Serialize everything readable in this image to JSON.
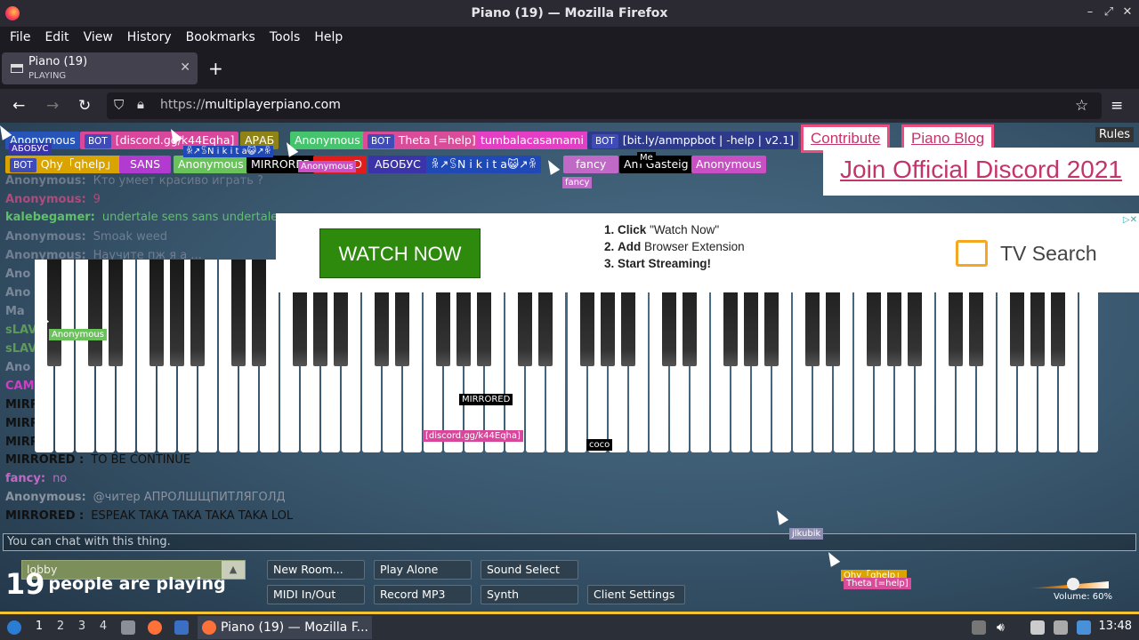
{
  "window": {
    "title": "Piano (19) — Mozilla Firefox"
  },
  "menu": [
    "File",
    "Edit",
    "View",
    "History",
    "Bookmarks",
    "Tools",
    "Help"
  ],
  "tab": {
    "title": "Piano (19)",
    "status": "PLAYING"
  },
  "url": {
    "scheme": "https://",
    "host": "multiplayerpiano.com"
  },
  "users_row1": [
    {
      "name": "Anonymous",
      "color": "#2754b8"
    },
    {
      "name": "[discord.gg/k44Eqha]",
      "color": "#d9479c",
      "bot": "BOT"
    },
    {
      "name": "АРАБ",
      "color": "#8f8217"
    },
    {
      "name": "Anonymous",
      "color": "#45c46d"
    },
    {
      "name": "Theta [=help]",
      "color": "#d94c9a",
      "bot": "BOT"
    },
    {
      "name": "tumbalacasamami",
      "color": "#e43fc4"
    },
    {
      "name": "[bit.ly/anmppbot | -help | v2.1]",
      "color": "#2d3a8c",
      "bot": "BOT"
    }
  ],
  "users_row2": [
    {
      "name": "Qhy「qhelp」",
      "color": "#d9a400",
      "bot": "BOT"
    },
    {
      "name": "SANS",
      "color": "#b23ad1"
    },
    {
      "name": "Anonymous",
      "color": "#69c35a"
    },
    {
      "name": "MIRRORED",
      "color": "#000000"
    },
    {
      "name": "D",
      "color": "#e01d1d"
    },
    {
      "name": "АБОБУС",
      "color": "#3b34a8"
    },
    {
      "name": "ꆜ↗ꌗN i k i t a😺↗ꆜ",
      "color": "#2049b8"
    },
    {
      "name": "fancy",
      "color": "#c169c6"
    },
    {
      "name": "Am Gasteig",
      "color": "#000000"
    },
    {
      "name": "Anonymous",
      "color": "#c94fc4"
    }
  ],
  "header_links": {
    "contribute": "Contribute",
    "blog": "Piano Blog",
    "join": "Join Official Discord 2021",
    "rules": "Rules"
  },
  "chat": [
    {
      "name": "Anonymous:",
      "text": "Кто умеет красиво играть ?",
      "color": "#6d7a8c"
    },
    {
      "name": "Anonymous:",
      "text": "9",
      "color": "#b04a7c"
    },
    {
      "name": "kalebegamer:",
      "text": "undertale sens sans undertale",
      "color": "#5fbf6a"
    },
    {
      "name": "Anonymous:",
      "text": "Smoak weed",
      "color": "#6f7e90"
    },
    {
      "name": "Anonymous:",
      "text": "Научите пж я а ...",
      "color": "#6f7e90"
    },
    {
      "name": "Ano",
      "text": "",
      "color": "#7a8798"
    },
    {
      "name": "Ano",
      "text": "",
      "color": "#7a8798"
    },
    {
      "name": "Ma",
      "text": "",
      "color": "#7a8798"
    },
    {
      "name": "sLAV",
      "text": "",
      "color": "#5e9a5a"
    },
    {
      "name": "sLAV",
      "text": "",
      "color": "#5e9a5a"
    },
    {
      "name": "Ano",
      "text": "",
      "color": "#7a8798"
    },
    {
      "name": "CAM",
      "text": "",
      "color": "#d23cc8"
    },
    {
      "name": "MIRR",
      "text": "",
      "color": "#111111"
    },
    {
      "name": "MIRR",
      "text": "",
      "color": "#111111"
    },
    {
      "name": "MIRR",
      "text": "",
      "color": "#111111"
    },
    {
      "name": "MIRRORED :",
      "text": "TO BE CONTINUE",
      "color": "#111111"
    },
    {
      "name": "fancy:",
      "text": "no",
      "color": "#c169c6"
    },
    {
      "name": "Anonymous:",
      "text": "@читер АПРОЛШЩПИТЛЯГОЛД",
      "color": "#8a93a0"
    },
    {
      "name": "MIRRORED :",
      "text": "ESPEAK TAKA TAKA TAKA TAKA LOL",
      "color": "#111111"
    }
  ],
  "ad": {
    "button": "WATCH NOW",
    "steps": [
      {
        "num": "1.",
        "verb": "Click",
        "rest": "\"Watch Now\""
      },
      {
        "num": "2.",
        "verb": "Add",
        "rest": "Browser Extension"
      },
      {
        "num": "3.",
        "verb": "Start Streaming!",
        "rest": ""
      }
    ],
    "brand": "TV Search"
  },
  "cursor_tags": [
    {
      "name": "АБОБУС",
      "color": "#3b34a8"
    },
    {
      "name": "ꆜ↗ꌗN i k i t a😺↗ꆜ",
      "color": "#2049b8"
    },
    {
      "name": "Anonymous",
      "color": "#c94fc4"
    },
    {
      "name": "Me",
      "color": "#000000"
    },
    {
      "name": "fancy",
      "color": "#c169c6"
    },
    {
      "name": "Anonymous",
      "color": "#69c35a"
    },
    {
      "name": "MIRRORED",
      "color": "#000000"
    },
    {
      "name": "[discord.gg/k44Eqha]",
      "color": "#d9479c"
    },
    {
      "name": "coco",
      "color": "#000000"
    },
    {
      "name": "jlkubik",
      "color": "#8e8fb3"
    },
    {
      "name": "Qhy「qhelp」",
      "color": "#d9a400"
    },
    {
      "name": "Theta [=help]",
      "color": "#d94c9a"
    }
  ],
  "chat_placeholder": "You can chat with this thing.",
  "room": {
    "name": "lobby",
    "count": "19",
    "count_text": "people are playing"
  },
  "buttons": {
    "new_room": "New Room...",
    "play_alone": "Play Alone",
    "sound_select": "Sound Select",
    "midi": "MIDI In/Out",
    "record": "Record MP3",
    "synth": "Synth",
    "client_settings": "Client Settings"
  },
  "volume": {
    "label": "Volume: 60%",
    "level": 0.6
  },
  "taskbar": {
    "workspaces": [
      "1",
      "2",
      "3",
      "4"
    ],
    "active_window": "Piano (19) — Mozilla F...",
    "clock": "13:48"
  }
}
